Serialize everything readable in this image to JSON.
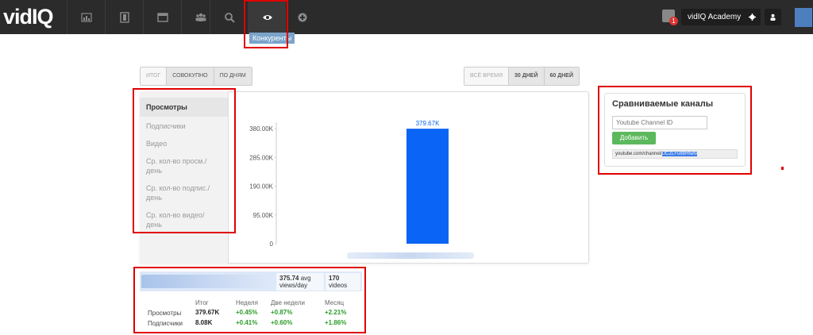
{
  "brand": {
    "logo_text": "vidIQ"
  },
  "nav": {
    "items": [
      {
        "name": "dashboard",
        "icon": "bar-chart-icon"
      },
      {
        "name": "video",
        "icon": "film-icon"
      },
      {
        "name": "browser",
        "icon": "window-icon"
      },
      {
        "name": "community",
        "icon": "users-icon"
      },
      {
        "name": "search",
        "icon": "search-icon"
      },
      {
        "name": "competitors",
        "icon": "eye-icon",
        "active": true
      },
      {
        "name": "add",
        "icon": "plus-circle-icon"
      }
    ],
    "tooltip": "Конкуренты"
  },
  "topright": {
    "notif_count": "1",
    "academy_label": "vidIQ Academy",
    "settings_icon": "gear-icon",
    "user_icon": "user-icon"
  },
  "view_tabs": [
    "ИТОГ",
    "СОВОКУПНО",
    "ПО ДНЯМ"
  ],
  "view_tabs_selected": 0,
  "range_tabs": [
    "ВСЁ ВРЕМЯ",
    "30 ДНЕЙ",
    "60 ДНЕЙ"
  ],
  "range_tabs_selected": 0,
  "metrics": [
    {
      "label": "Просмотры",
      "selected": true
    },
    {
      "label": "Подписчики"
    },
    {
      "label": "Видео"
    },
    {
      "label": "Ср. кол-во просм./ день"
    },
    {
      "label": "Ср. кол-во подпис./ день"
    },
    {
      "label": "Ср. кол-во видео/ день"
    }
  ],
  "chart_data": {
    "type": "bar",
    "categories": [
      ""
    ],
    "values": [
      379670
    ],
    "data_labels": [
      "379.67K"
    ],
    "y_ticks": [
      "380.00K",
      "285.00K",
      "190.00K",
      "95.00K",
      "0"
    ],
    "y_tick_values": [
      380000,
      285000,
      190000,
      95000,
      0
    ],
    "ylim": [
      0,
      380000
    ],
    "bar_color": "#0a64f5",
    "grid": false
  },
  "compare": {
    "title": "Сравниваемые каналы",
    "input_placeholder": "Youtube Channel ID",
    "add_label": "Добавить",
    "url_prefix": "youtube.com/channel/",
    "url_id": "UCZLFu8bHtwtv"
  },
  "stats": {
    "avg_views_value": "375.74",
    "avg_views_label_1": "avg",
    "avg_views_label_2": "views/day",
    "videos_value": "170",
    "videos_label": "videos",
    "headers": [
      "Итог",
      "Неделя",
      "Две недели",
      "Месяц"
    ],
    "rows": [
      {
        "label": "Просмотры",
        "total": "379.67K",
        "week": "+0.45%",
        "two_weeks": "+0.87%",
        "month": "+2.21%"
      },
      {
        "label": "Подписчики",
        "total": "8.08K",
        "week": "+0.41%",
        "two_weeks": "+0.60%",
        "month": "+1.86%"
      }
    ]
  },
  "colors": {
    "accent": "#0a64f5",
    "highlight": "#e00000",
    "positive": "#2a9d2a",
    "add_button": "#5cb85c"
  }
}
